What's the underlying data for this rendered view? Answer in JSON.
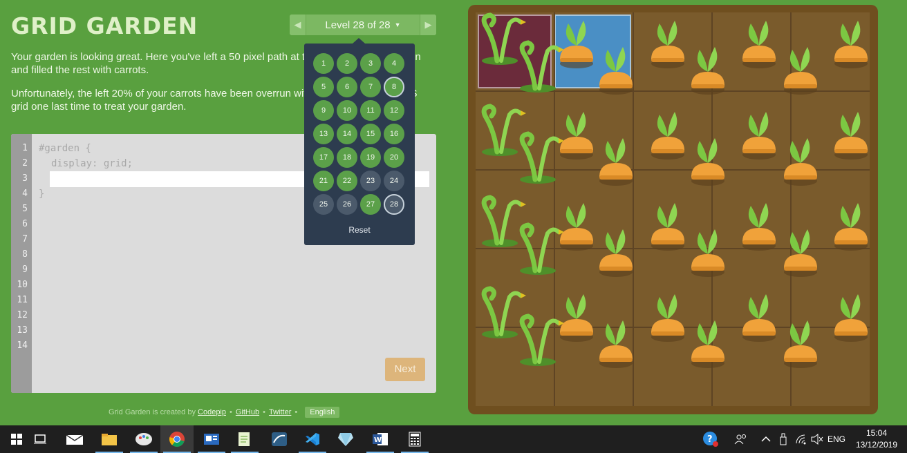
{
  "app": {
    "title": "GRID GARDEN"
  },
  "level_nav": {
    "prev_icon": "triangle-left-icon",
    "next_icon": "triangle-right-icon",
    "label": "Level 28 of 28",
    "caret": "▼"
  },
  "instructions": {
    "p1": "Your garden is looking great. Here you've left a 50 pixel path at the bottom of your garden and filled the rest with carrots.",
    "p2": "Unfortunately, the left 20% of your carrots have been overrun with weeds. Try using CSS grid one last time to treat your garden."
  },
  "editor": {
    "line_numbers": [
      "1",
      "2",
      "3",
      "4",
      "5",
      "6",
      "7",
      "8",
      "9",
      "10",
      "11",
      "12",
      "13",
      "14"
    ],
    "line1": "#garden {",
    "line2": "display: grid;",
    "line4": "}",
    "input_value": "",
    "next_label": "Next"
  },
  "level_menu": {
    "levels": [
      {
        "n": "1",
        "state": "solved"
      },
      {
        "n": "2",
        "state": "solved"
      },
      {
        "n": "3",
        "state": "solved"
      },
      {
        "n": "4",
        "state": "solved"
      },
      {
        "n": "5",
        "state": "solved"
      },
      {
        "n": "6",
        "state": "solved"
      },
      {
        "n": "7",
        "state": "solved"
      },
      {
        "n": "8",
        "state": "solved-current"
      },
      {
        "n": "9",
        "state": "solved"
      },
      {
        "n": "10",
        "state": "solved"
      },
      {
        "n": "11",
        "state": "solved"
      },
      {
        "n": "12",
        "state": "solved"
      },
      {
        "n": "13",
        "state": "solved"
      },
      {
        "n": "14",
        "state": "solved"
      },
      {
        "n": "15",
        "state": "solved"
      },
      {
        "n": "16",
        "state": "solved"
      },
      {
        "n": "17",
        "state": "solved"
      },
      {
        "n": "18",
        "state": "solved"
      },
      {
        "n": "19",
        "state": "solved"
      },
      {
        "n": "20",
        "state": "solved"
      },
      {
        "n": "21",
        "state": "solved"
      },
      {
        "n": "22",
        "state": "solved"
      },
      {
        "n": "23",
        "state": "unsolved"
      },
      {
        "n": "24",
        "state": "unsolved"
      },
      {
        "n": "25",
        "state": "unsolved"
      },
      {
        "n": "26",
        "state": "unsolved"
      },
      {
        "n": "27",
        "state": "solved"
      },
      {
        "n": "28",
        "state": "unsolved-current"
      }
    ],
    "reset_label": "Reset"
  },
  "footer": {
    "prefix": "Grid Garden is created by",
    "codepip": "Codepip",
    "bullet": "•",
    "github": "GitHub",
    "twitter": "Twitter",
    "language": "English"
  },
  "taskbar": {
    "icons": [
      "windows-start-icon",
      "task-view-icon",
      "mail-icon",
      "file-explorer-icon",
      "paint-icon",
      "chrome-icon",
      "news-icon",
      "notepad-icon",
      "mysql-workbench-icon",
      "vscode-icon",
      "sketch-icon",
      "word-icon",
      "calculator-icon"
    ],
    "tray_language": "ENG",
    "time": "15:04",
    "date": "13/12/2019"
  },
  "colors": {
    "background": "#59a03f",
    "soil": "#7a5b2c",
    "carrot": "#f0a23a",
    "leaf": "#7cc842",
    "weeds": "#6b2b3b",
    "water": "#4a8fc5"
  }
}
